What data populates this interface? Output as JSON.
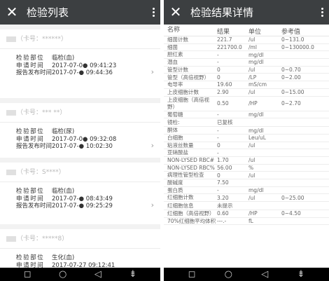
{
  "left": {
    "title": "检验列表",
    "close_icon": "✕",
    "nav": [
      "◻",
      "○",
      "◁",
      "⇟"
    ],
    "label_dept": "检验部位",
    "label_apply": "申请时间",
    "label_report": "报告发布时间",
    "cards": [
      {
        "name": "***",
        "cardno": "（卡号：******）",
        "dept": "临检(血)",
        "apply": "2017-07-0● 09:41:23",
        "report": "2017-07-● 09:44:36"
      },
      {
        "name": "***",
        "cardno": "（卡号：*** **）",
        "dept": "临检(尿)",
        "apply": "2017-07-0● 09:32:08",
        "report": "2017-07-● 10:02:30"
      },
      {
        "name": "***",
        "cardno": "（卡号：S****）",
        "dept": "临检(血)",
        "apply": "2017-07-● 08:43:49",
        "report": "2017-07-● 09:25:29"
      },
      {
        "name": "***",
        "cardno": "（卡号：*****8）",
        "dept": "生化(血)",
        "apply": "2017-07-27 09:12:41",
        "report": ""
      }
    ]
  },
  "right": {
    "title": "检验结果详情",
    "close_icon": "✕",
    "nav": [
      "◻",
      "○",
      "◁",
      "⇟"
    ],
    "headers": [
      "名称",
      "结果",
      "单位",
      "参考值"
    ],
    "rows": [
      {
        "name": "细菌计数",
        "result": "221.7",
        "unit": "/ul",
        "ref": "0~131.0"
      },
      {
        "name": "细菌",
        "result": "221700.0",
        "unit": "/ml",
        "ref": "0~130000.0"
      },
      {
        "name": "胆红素",
        "result": "-",
        "unit": "mg/dl",
        "ref": ""
      },
      {
        "name": "潜血",
        "result": "-",
        "unit": "mg/dl",
        "ref": ""
      },
      {
        "name": "管型计数",
        "result": "0",
        "unit": "/ul",
        "ref": "0~0.70"
      },
      {
        "name": "管型（高倍视野）",
        "result": "0",
        "unit": "/LP",
        "ref": "0~2.00"
      },
      {
        "name": "电导率",
        "result": "19.60",
        "unit": "mS/cm",
        "ref": ""
      },
      {
        "name": "上皮细胞计数",
        "result": "2.90",
        "unit": "/ul",
        "ref": "0~15.00"
      },
      {
        "name": "上皮细胞（高倍视野）",
        "result": "0.50",
        "unit": "/HP",
        "ref": "0~2.70",
        "tall": true
      },
      {
        "name": "葡萄糖",
        "result": "-",
        "unit": "mg/dl",
        "ref": ""
      },
      {
        "name": "镜检:",
        "result": "已复核",
        "unit": "",
        "ref": ""
      },
      {
        "name": "酮体",
        "result": "-",
        "unit": "mg/dl",
        "ref": ""
      },
      {
        "name": "白细胞",
        "result": "-",
        "unit": "Leu/uL",
        "ref": ""
      },
      {
        "name": "粘液丝数量",
        "result": "0",
        "unit": "/ul",
        "ref": ""
      },
      {
        "name": "亚硝酸盐",
        "result": "-",
        "unit": "",
        "ref": ""
      },
      {
        "name": "NON-LYSED RBC#",
        "result": "1.70",
        "unit": "/ul",
        "ref": ""
      },
      {
        "name": "NON-LYSED RBC%",
        "result": "56.00",
        "unit": "%",
        "ref": ""
      },
      {
        "name": "病理性管型检查",
        "result": "0",
        "unit": "/ul",
        "ref": ""
      },
      {
        "name": "酸碱度",
        "result": "7.50",
        "unit": "",
        "ref": ""
      },
      {
        "name": "蛋白质",
        "result": "-",
        "unit": "mg/dl",
        "ref": ""
      },
      {
        "name": "红细胞计数",
        "result": "3.20",
        "unit": "/ul",
        "ref": "0~25.00"
      },
      {
        "name": "红细胞信息",
        "result": "未提示",
        "unit": "",
        "ref": ""
      },
      {
        "name": "红细胞（高倍视野）",
        "result": "0.60",
        "unit": "/HP",
        "ref": "0~4.50"
      },
      {
        "name": "70%红细胞平均体积",
        "result": "---.-",
        "unit": "fL",
        "ref": ""
      }
    ]
  }
}
